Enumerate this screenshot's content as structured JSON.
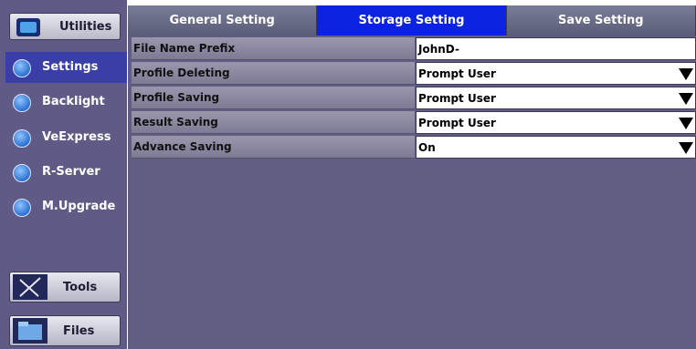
{
  "sidebar": {
    "utilities_label": "Utilities",
    "items": [
      {
        "label": "Settings",
        "icon": "settings-icon",
        "active": true
      },
      {
        "label": "Backlight",
        "icon": "backlight-icon",
        "active": false
      },
      {
        "label": "VeExpress",
        "icon": "veexpress-icon",
        "active": false
      },
      {
        "label": "R-Server",
        "icon": "r-server-icon",
        "active": false
      },
      {
        "label": "M.Upgrade",
        "icon": "upgrade-icon",
        "active": false
      }
    ],
    "tools_label": "Tools",
    "files_label": "Files"
  },
  "tabs": [
    {
      "label": "General Setting",
      "active": false
    },
    {
      "label": "Storage Setting",
      "active": true
    },
    {
      "label": "Save Setting",
      "active": false
    }
  ],
  "settings": [
    {
      "label": "File Name Prefix",
      "value": "JohnD-",
      "dropdown": false
    },
    {
      "label": "Profile Deleting",
      "value": "Prompt User",
      "dropdown": true
    },
    {
      "label": "Profile Saving",
      "value": "Prompt User",
      "dropdown": true
    },
    {
      "label": "Result Saving",
      "value": "Prompt User",
      "dropdown": true
    },
    {
      "label": "Advance Saving",
      "value": "On",
      "dropdown": true
    }
  ],
  "colors": {
    "sidebar_bg": "#5f5a86",
    "content_bg": "#625d82",
    "active_tab": "#0b22e0",
    "active_side_item": "#3a3fa8"
  }
}
